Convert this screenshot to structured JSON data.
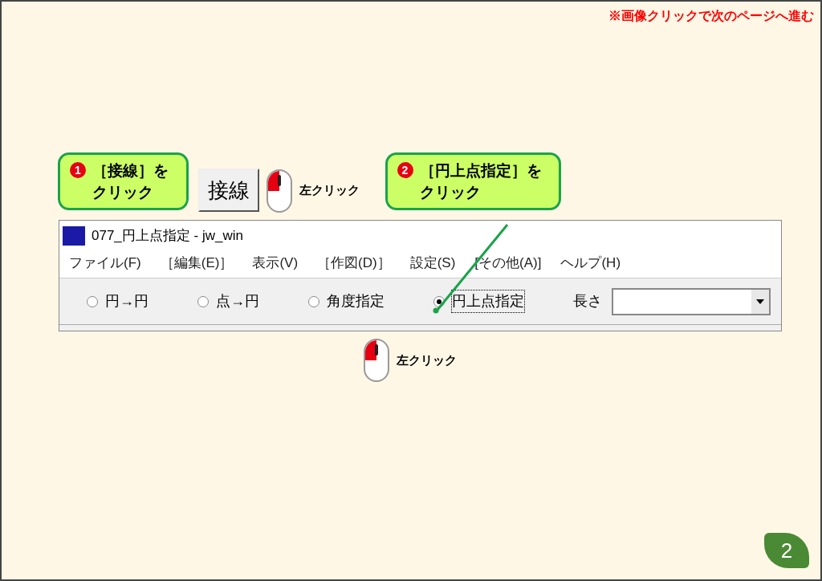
{
  "note": "※画像クリックで次のページへ進む",
  "steps": [
    {
      "number": "1",
      "text": "［接線］をクリック"
    },
    {
      "number": "2",
      "text": "［円上点指定］をクリック"
    }
  ],
  "tool_button": "接線",
  "click_labels": [
    "左クリック",
    "左クリック"
  ],
  "window": {
    "title": "077_円上点指定 - jw_win",
    "menu": [
      "ファイル(F)",
      "［編集(E)］",
      "表示(V)",
      "［作図(D)］",
      "設定(S)",
      "[その他(A)]",
      "ヘルプ(H)"
    ],
    "options": [
      {
        "label": "円→円",
        "selected": false
      },
      {
        "label": "点→円",
        "selected": false
      },
      {
        "label": "角度指定",
        "selected": false
      },
      {
        "label": "円上点指定",
        "selected": true
      }
    ],
    "length_label": "長さ"
  },
  "page_number": "2"
}
